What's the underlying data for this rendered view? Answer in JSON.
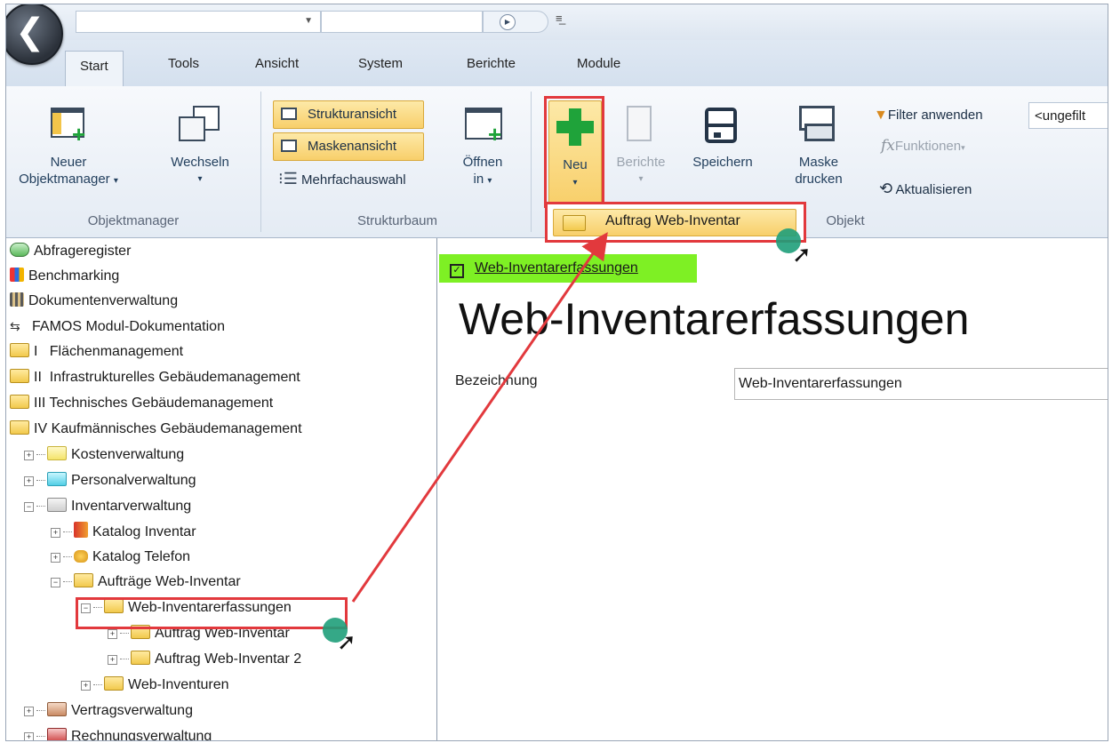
{
  "quick_access": {
    "combo1_value": "",
    "combo2_value": ""
  },
  "tabs": [
    "Start",
    "Tools",
    "Ansicht",
    "System",
    "Berichte",
    "Module"
  ],
  "ribbon": {
    "objektmanager": {
      "label": "Objektmanager",
      "neuer_line1": "Neuer",
      "neuer_line2": "Objektmanager",
      "wechseln": "Wechseln"
    },
    "strukturbaum": {
      "label": "Strukturbaum",
      "strukturansicht": "Strukturansicht",
      "maskenansicht": "Maskenansicht",
      "mehrfachauswahl": "Mehrfachauswahl",
      "oeffnen_line1": "Öffnen",
      "oeffnen_line2": "in"
    },
    "objekt": {
      "label": "Objekt",
      "neu": "Neu",
      "berichte": "Berichte",
      "speichern": "Speichern",
      "maske_line1": "Maske",
      "maske_line2": "drucken",
      "filter_anwenden": "Filter anwenden",
      "filter_value": "<ungefilt",
      "funktionen": "Funktionen",
      "aktualisieren": "Aktualisieren"
    }
  },
  "dropdown": {
    "item": "Auftrag Web-Inventar"
  },
  "tree": [
    {
      "label": "Abfrageregister"
    },
    {
      "label": "Benchmarking"
    },
    {
      "label": "Dokumentenverwaltung"
    },
    {
      "label": "FAMOS Modul-Dokumentation"
    },
    {
      "label": "I   Flächenmanagement"
    },
    {
      "label": "II  Infrastrukturelles Gebäudemanagement"
    },
    {
      "label": "III Technisches Gebäudemanagement"
    },
    {
      "label": "IV Kaufmännisches Gebäudemanagement"
    },
    {
      "label": "Kostenverwaltung"
    },
    {
      "label": "Personalverwaltung"
    },
    {
      "label": "Inventarverwaltung"
    },
    {
      "label": "Katalog Inventar"
    },
    {
      "label": "Katalog Telefon"
    },
    {
      "label": "Aufträge Web-Inventar"
    },
    {
      "label": "Web-Inventarerfassungen"
    },
    {
      "label": "Auftrag Web-Inventar"
    },
    {
      "label": "Auftrag Web-Inventar 2"
    },
    {
      "label": "Web-Inventuren"
    },
    {
      "label": "Vertragsverwaltung"
    },
    {
      "label": "Rechnungsverwaltung"
    }
  ],
  "content": {
    "tab_label": "Web-Inventarerfassungen",
    "title": "Web-Inventarerfassungen",
    "field_label": "Bezeichnung",
    "field_value": "Web-Inventarerfassungen"
  },
  "colors": {
    "annotation": "#e2393d",
    "tab_green": "#7ef024",
    "accent_blue": "#23405e"
  }
}
